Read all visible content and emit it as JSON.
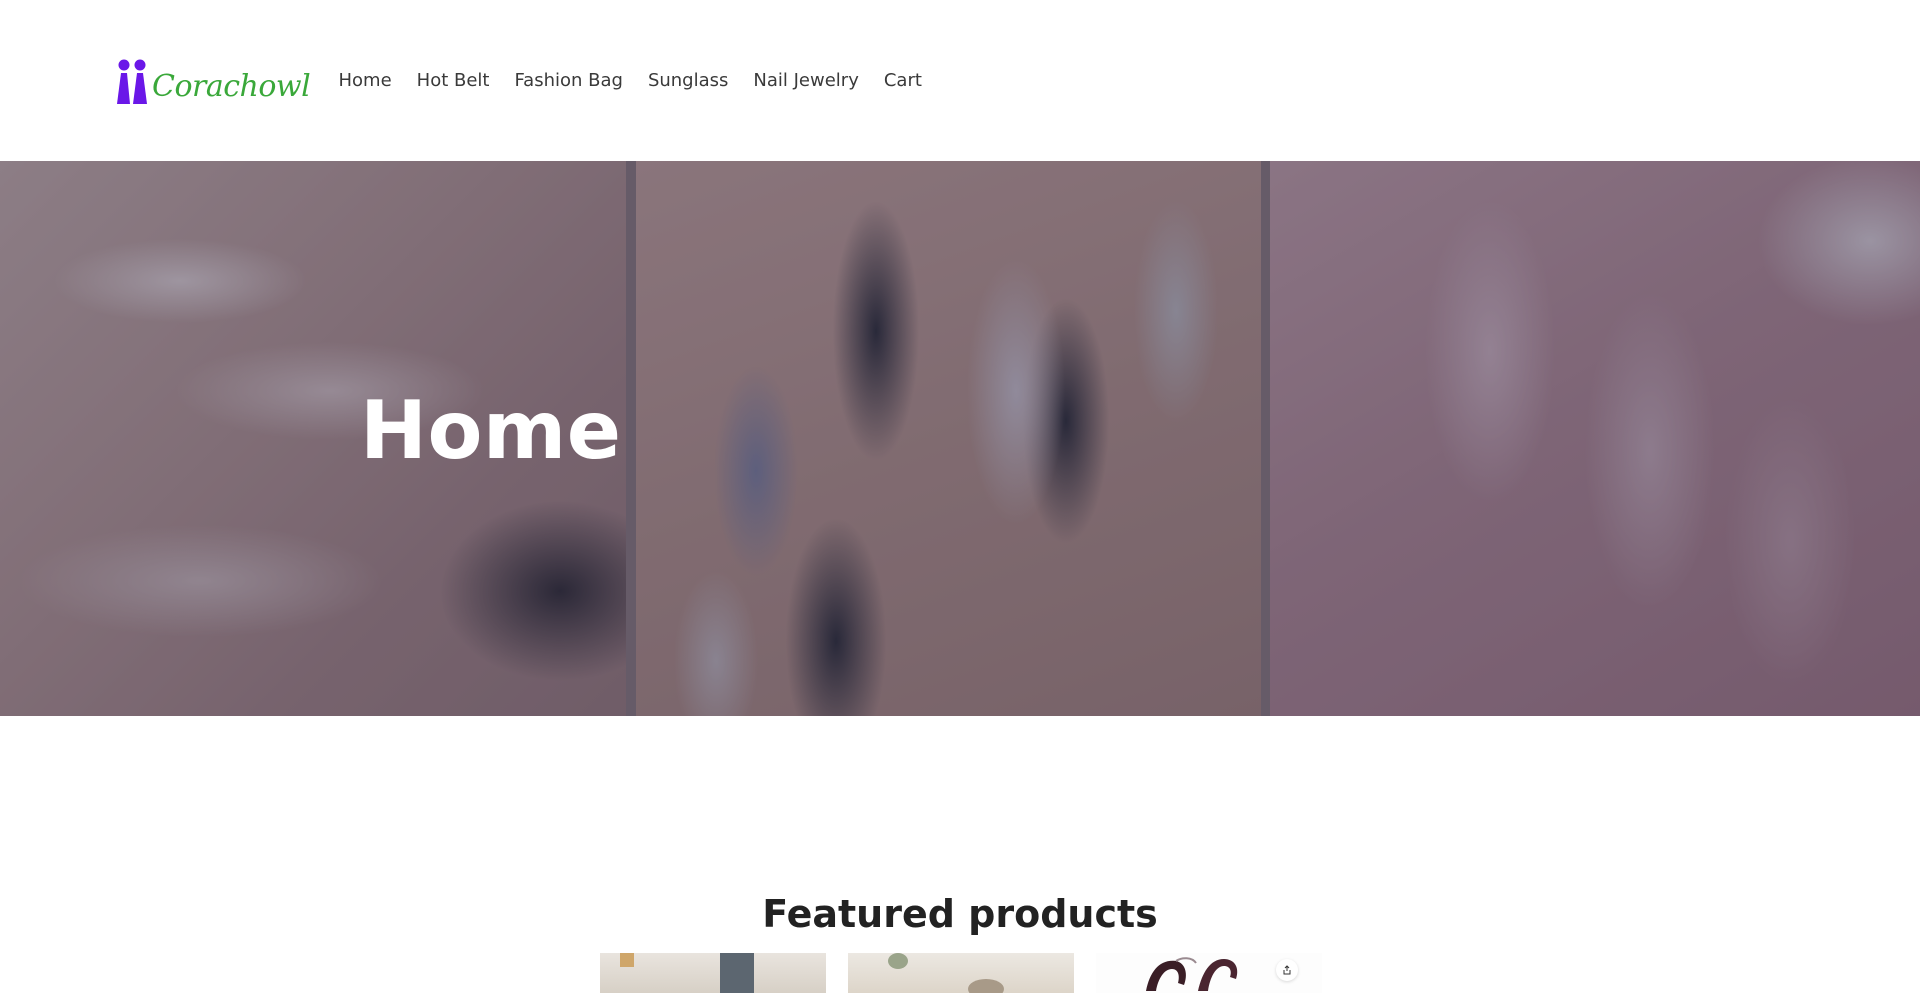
{
  "header": {
    "logo_text": "Corachowl",
    "nav": [
      {
        "label": "Home"
      },
      {
        "label": "Hot Belt"
      },
      {
        "label": "Fashion Bag"
      },
      {
        "label": "Sunglass"
      },
      {
        "label": "Nail Jewelry"
      },
      {
        "label": "Cart"
      }
    ]
  },
  "hero": {
    "title": "Home"
  },
  "featured": {
    "title": "Featured products"
  },
  "colors": {
    "brand_purple": "#6a17e8",
    "brand_green": "#3aa83a",
    "text_dark": "#222222"
  },
  "icons": {
    "logo": "two-figures-logo-icon",
    "share": "share-icon"
  }
}
